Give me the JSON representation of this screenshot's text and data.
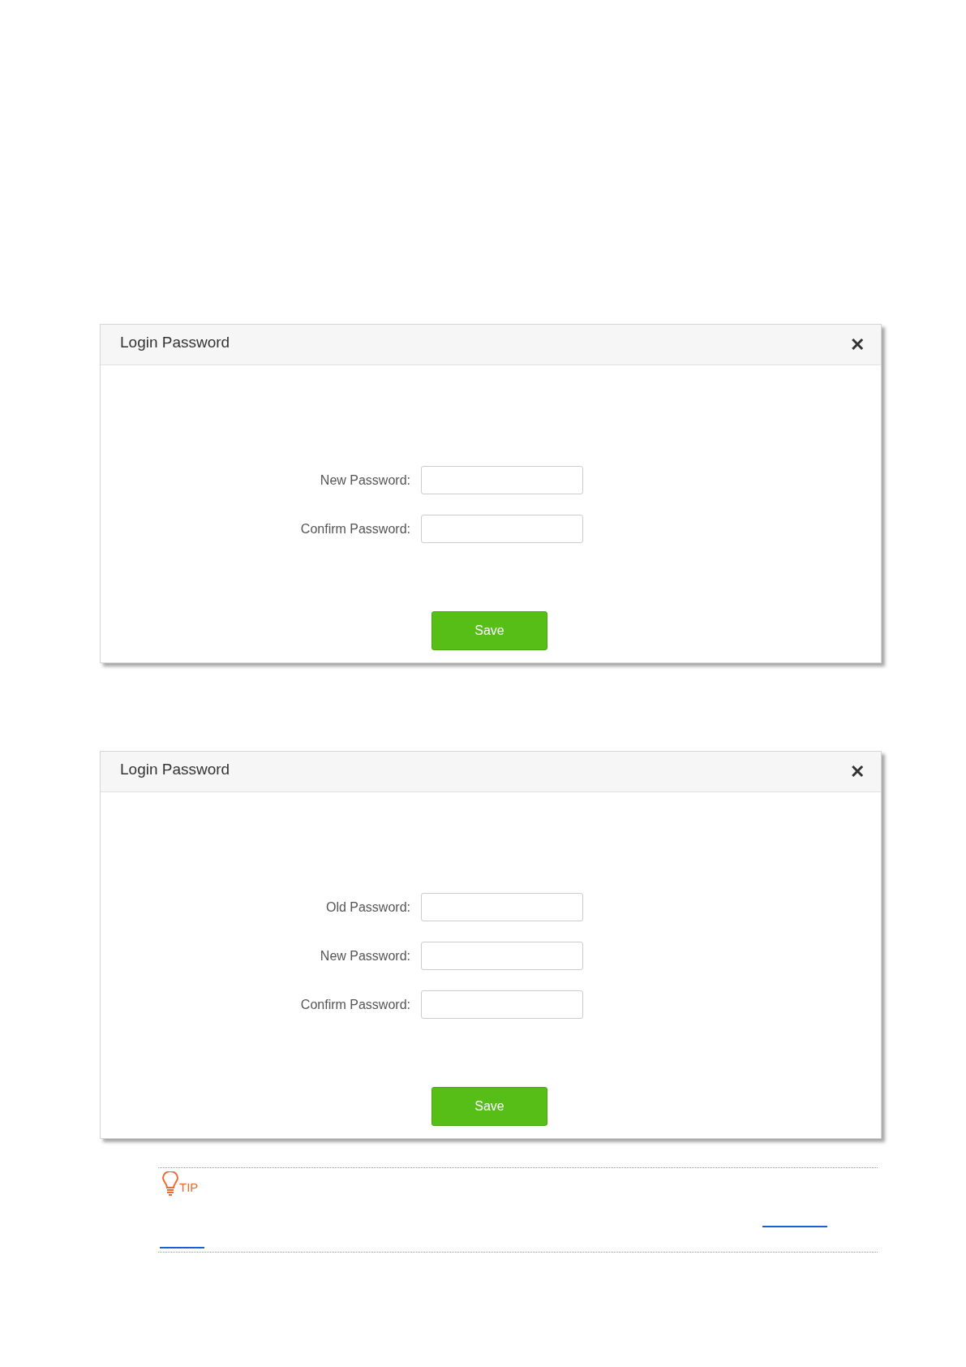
{
  "dialogs": [
    {
      "title": "Login Password",
      "close": "✕",
      "fields": [
        {
          "label": "New Password:"
        },
        {
          "label": "Confirm Password:"
        }
      ],
      "button": "Save"
    },
    {
      "title": "Login Password",
      "close": "✕",
      "fields": [
        {
          "label": "Old Password:"
        },
        {
          "label": "New Password:"
        },
        {
          "label": "Confirm Password:"
        }
      ],
      "button": "Save"
    }
  ],
  "tip": {
    "label": "TIP"
  }
}
